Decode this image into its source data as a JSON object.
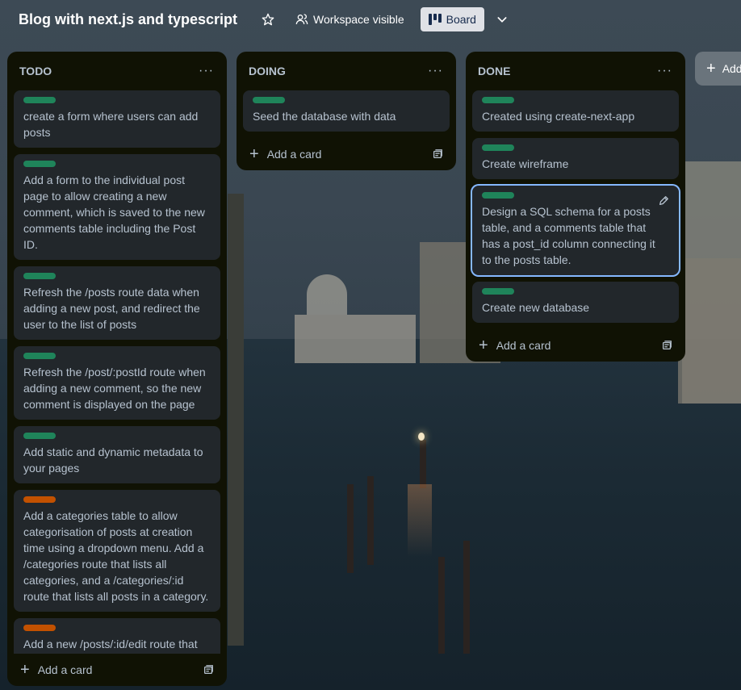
{
  "header": {
    "board_title": "Blog with next.js and typescript",
    "visibility_label": "Workspace visible",
    "view_label": "Board"
  },
  "colors": {
    "label_green": "#1f845a",
    "label_orange": "#c25100",
    "list_bg": "#101204",
    "card_bg": "#22272b",
    "selected_ring": "#85b8ff"
  },
  "lists": [
    {
      "title": "TODO",
      "cards": [
        {
          "label": "green",
          "text": "create a form where users can add posts"
        },
        {
          "label": "green",
          "text": "Add a form to the individual post page to allow creating a new comment, which is saved to the new comments table including the Post ID."
        },
        {
          "label": "green",
          "text": "Refresh the /posts route data when adding a new post, and redirect the user to the list of posts"
        },
        {
          "label": "green",
          "text": "Refresh the /post/:postId route when adding a new comment, so the new comment is displayed on the page"
        },
        {
          "label": "green",
          "text": "Add static and dynamic metadata to your pages"
        },
        {
          "label": "orange",
          "text": "Add a categories table to allow categorisation of posts at creation time using a dropdown menu. Add a /categories route that lists all categories, and a /categories/:id route that lists all posts in a category."
        },
        {
          "label": "orange",
          "text": "Add a new /posts/:id/edit route that allows editing a post. Populate the form with the post data, and save"
        }
      ],
      "add_card_label": "Add a card"
    },
    {
      "title": "DOING",
      "cards": [
        {
          "label": "green",
          "text": "Seed the database with data"
        }
      ],
      "add_card_label": "Add a card"
    },
    {
      "title": "DONE",
      "cards": [
        {
          "label": "green",
          "text": "Created using create-next-app"
        },
        {
          "label": "green",
          "text": "Create wireframe"
        },
        {
          "label": "green",
          "text": "Design a SQL schema for a posts table, and a comments table that has a post_id column connecting it to the posts table."
        },
        {
          "label": "green",
          "text": "Create new database"
        }
      ],
      "add_card_label": "Add a card"
    }
  ],
  "add_list_label": "Add"
}
